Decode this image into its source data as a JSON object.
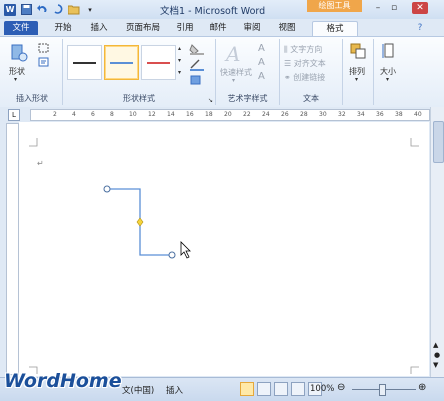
{
  "titlebar": {
    "title": "文档1 - Microsoft Word",
    "context_tab": "绘图工具",
    "app_icon": "W"
  },
  "tabs": [
    "文件",
    "开始",
    "插入",
    "页面布局",
    "引用",
    "邮件",
    "审阅",
    "视图",
    "格式"
  ],
  "ribbon": {
    "groups": {
      "insert_shapes": {
        "label": "插入形状",
        "button": "形状"
      },
      "shape_styles": {
        "label": "形状样式",
        "swatch_colors": [
          "#333333",
          "#5b8fd6",
          "#d94f4f"
        ]
      },
      "wordart": {
        "label": "艺术字样式",
        "quick_styles": "快速样式"
      },
      "text": {
        "label": "文本",
        "items": [
          "文字方向",
          "对齐文本",
          "创建链接"
        ]
      },
      "arrange": {
        "button": "排列"
      },
      "size": {
        "button": "大小"
      }
    }
  },
  "ruler": {
    "ticks": [
      "2",
      "4",
      "6",
      "8",
      "10",
      "12",
      "14",
      "16",
      "18",
      "20",
      "22",
      "24",
      "26",
      "28",
      "30",
      "32",
      "34",
      "36",
      "38",
      "40"
    ]
  },
  "status": {
    "language": "文(中国)",
    "mode": "插入",
    "zoom": "100%"
  },
  "brand": "WordHome"
}
